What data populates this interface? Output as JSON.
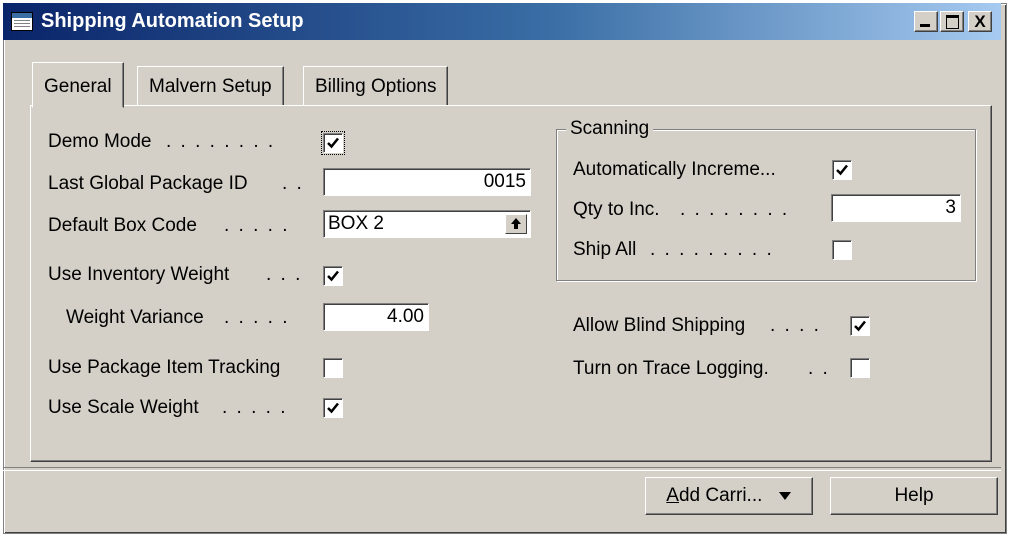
{
  "window": {
    "title": "Shipping Automation Setup",
    "minimize_label": "_",
    "close_label": "X"
  },
  "tabs": [
    {
      "label": "General",
      "active": true
    },
    {
      "label": "Malvern Setup",
      "active": false
    },
    {
      "label": "Billing Options",
      "active": false
    }
  ],
  "general": {
    "demo_mode": {
      "label": "Demo Mode",
      "checked": true
    },
    "last_global_package_id": {
      "label": "Last Global Package ID",
      "value": "0015"
    },
    "default_box_code": {
      "label": "Default Box Code",
      "value": "BOX 2"
    },
    "use_inventory_weight": {
      "label": "Use Inventory Weight",
      "checked": true
    },
    "weight_variance": {
      "label": "Weight Variance",
      "value": "4.00"
    },
    "use_package_item_tracking": {
      "label": "Use Package Item Tracking",
      "checked": false
    },
    "use_scale_weight": {
      "label": "Use Scale Weight",
      "checked": true
    }
  },
  "scanning": {
    "title": "Scanning",
    "auto_increment": {
      "label": "Automatically Increme...",
      "checked": true
    },
    "qty_to_inc": {
      "label": "Qty to Inc.",
      "value": "3"
    },
    "ship_all": {
      "label": "Ship All",
      "checked": false
    }
  },
  "right_options": {
    "allow_blind_shipping": {
      "label": "Allow Blind Shipping",
      "checked": true
    },
    "turn_on_trace_logging": {
      "label": "Turn on Trace Logging.",
      "checked": false
    }
  },
  "buttons": {
    "add_carrier": {
      "label": "Add Carri...",
      "mnemonic": "A",
      "rest": "dd Carri..."
    },
    "help": {
      "label": "Help"
    }
  },
  "dots": {
    "demo_mode": ". . . . . . . .",
    "last_global": ". .",
    "default_box": ". . . . .",
    "use_inventory": ". . .",
    "weight_variance": ". . . . .",
    "use_scale": ". . . . .",
    "qty_to_inc": ". . . . . . . .",
    "ship_all": ". . . . . . . . .",
    "allow_blind": ". . . .",
    "trace_logging": ". ."
  }
}
